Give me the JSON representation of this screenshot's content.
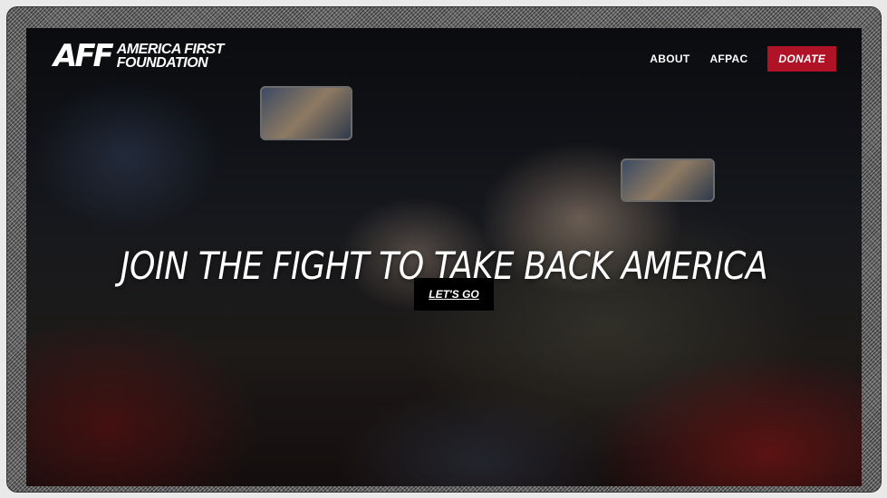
{
  "header": {
    "logo": {
      "mark": "AFF",
      "line1": "AMERICA FIRST",
      "line2": "FOUNDATION"
    },
    "nav": {
      "about": "ABOUT",
      "afpac": "AFPAC",
      "donate": "DONATE"
    }
  },
  "hero": {
    "headline": "JOIN THE FIGHT TO TAKE BACK AMERICA",
    "cta": "LET'S GO"
  },
  "colors": {
    "donate_bg": "#b01226",
    "cta_bg": "#000000",
    "text": "#ffffff"
  }
}
